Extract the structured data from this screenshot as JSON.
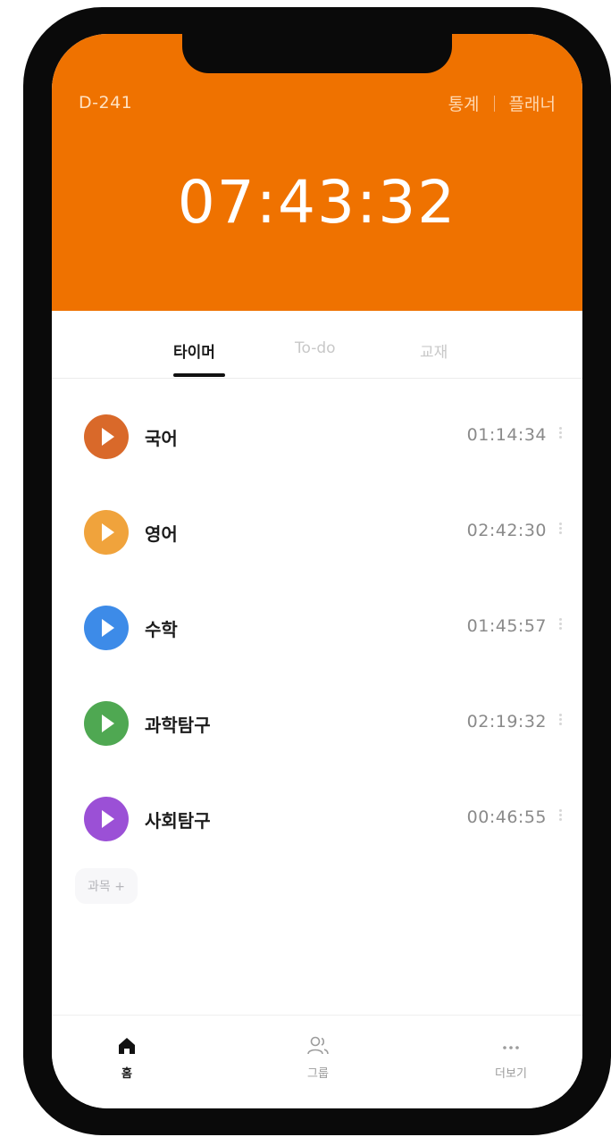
{
  "header": {
    "dday": "D-241",
    "stats_label": "통계",
    "planner_label": "플래너",
    "timer": "07:43:32",
    "color": "#ef7200"
  },
  "tabs": [
    {
      "label": "타이머",
      "active": true
    },
    {
      "label": "To-do",
      "active": false
    },
    {
      "label": "교재",
      "active": false
    }
  ],
  "subjects": [
    {
      "name": "국어",
      "time": "01:14:34",
      "color": "#d9692a",
      "icon": "play-icon"
    },
    {
      "name": "영어",
      "time": "02:42:30",
      "color": "#f0a33c",
      "icon": "play-icon"
    },
    {
      "name": "수학",
      "time": "01:45:57",
      "color": "#3d8be8",
      "icon": "play-icon"
    },
    {
      "name": "과학탐구",
      "time": "02:19:32",
      "color": "#4fa852",
      "icon": "play-icon"
    },
    {
      "name": "사회탐구",
      "time": "00:46:55",
      "color": "#9b50d6",
      "icon": "play-icon"
    }
  ],
  "add_subject_label": "과목 +",
  "bottom_nav": [
    {
      "label": "홈",
      "icon": "home-icon",
      "active": true
    },
    {
      "label": "그룹",
      "icon": "group-icon",
      "active": false
    },
    {
      "label": "더보기",
      "icon": "more-icon",
      "active": false
    }
  ]
}
